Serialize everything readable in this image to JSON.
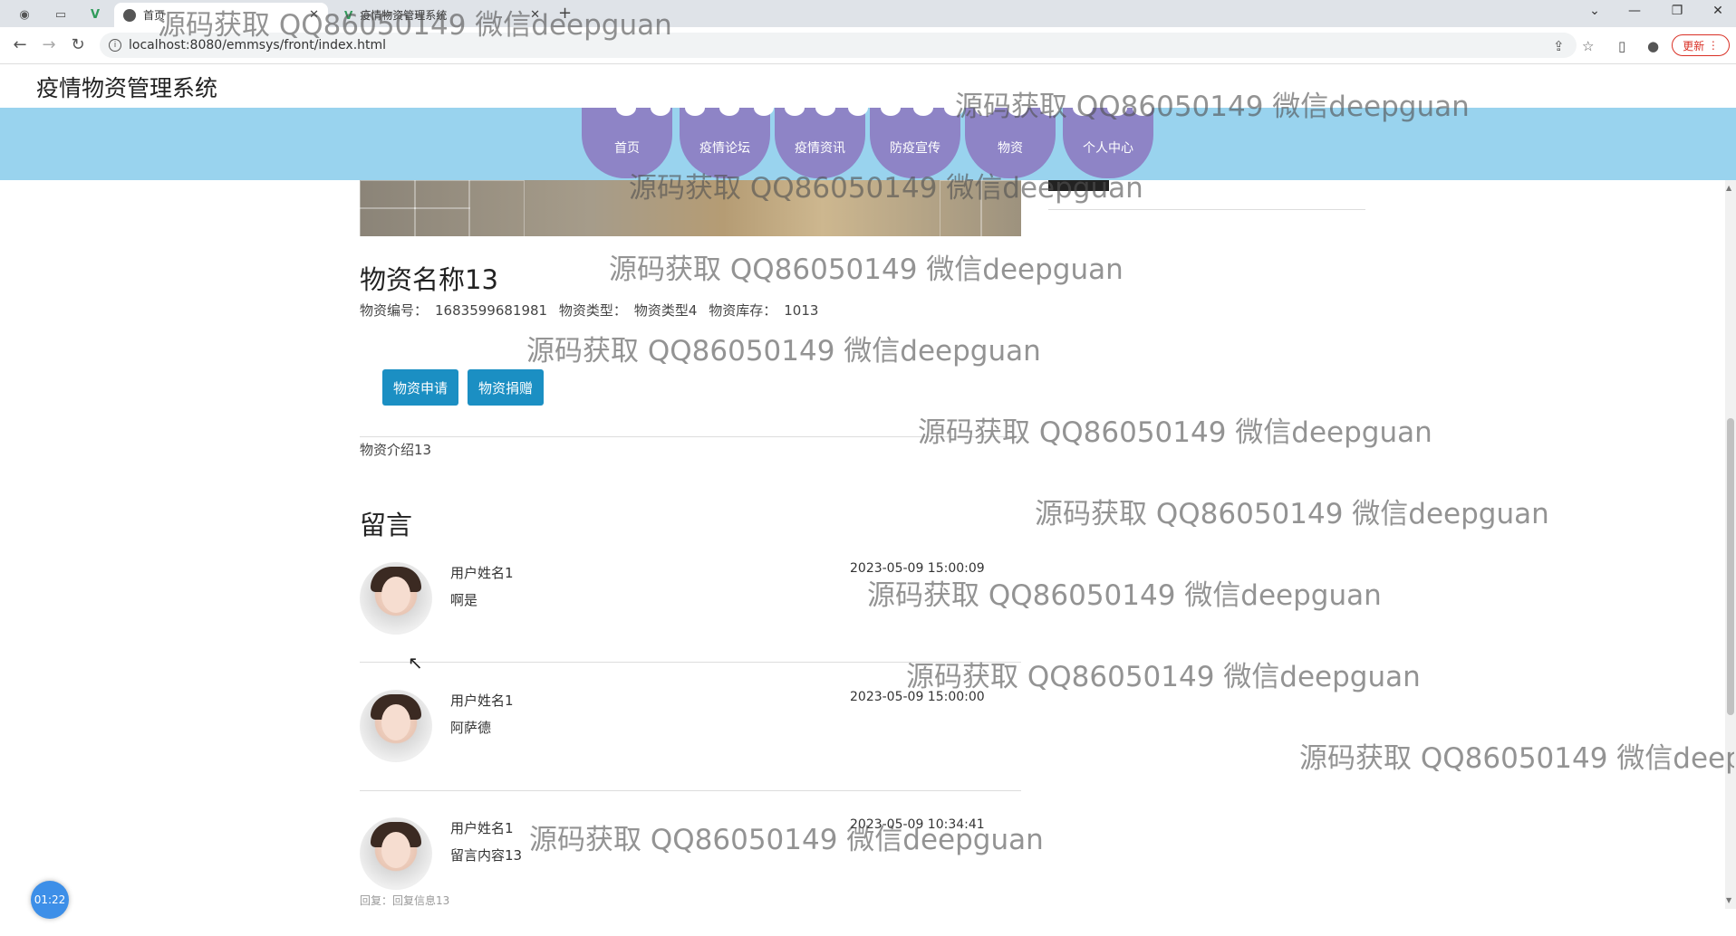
{
  "browser": {
    "tabs": [
      {
        "label": "首页",
        "active": true
      },
      {
        "label": "疫情物资管理系统",
        "active": false
      }
    ],
    "url": "localhost:8080/emmsys/front/index.html",
    "update_label": "更新"
  },
  "site": {
    "title": "疫情物资管理系统",
    "nav": [
      "首页",
      "疫情论坛",
      "疫情资讯",
      "防疫宣传",
      "物资",
      "个人中心"
    ]
  },
  "product": {
    "name": "物资名称13",
    "code_label": "物资编号：",
    "code_value": "1683599681981",
    "type_label": "物资类型：",
    "type_value": "物资类型4",
    "stock_label": "物资库存：",
    "stock_value": "1013",
    "apply_button": "物资申请",
    "donate_button": "物资捐赠",
    "intro": "物资介绍13"
  },
  "messages": {
    "title": "留言",
    "items": [
      {
        "user": "用户姓名1",
        "text": "啊是",
        "time": "2023-05-09 15:00:09"
      },
      {
        "user": "用户姓名1",
        "text": "阿萨德",
        "time": "2023-05-09 15:00:00"
      },
      {
        "user": "用户姓名1",
        "text": "留言内容13",
        "time": "2023-05-09 10:34:41"
      }
    ],
    "reply": "回复：回复信息13"
  },
  "timer": "01:22",
  "watermark": "源码获取 QQ86050149 微信deepguan"
}
